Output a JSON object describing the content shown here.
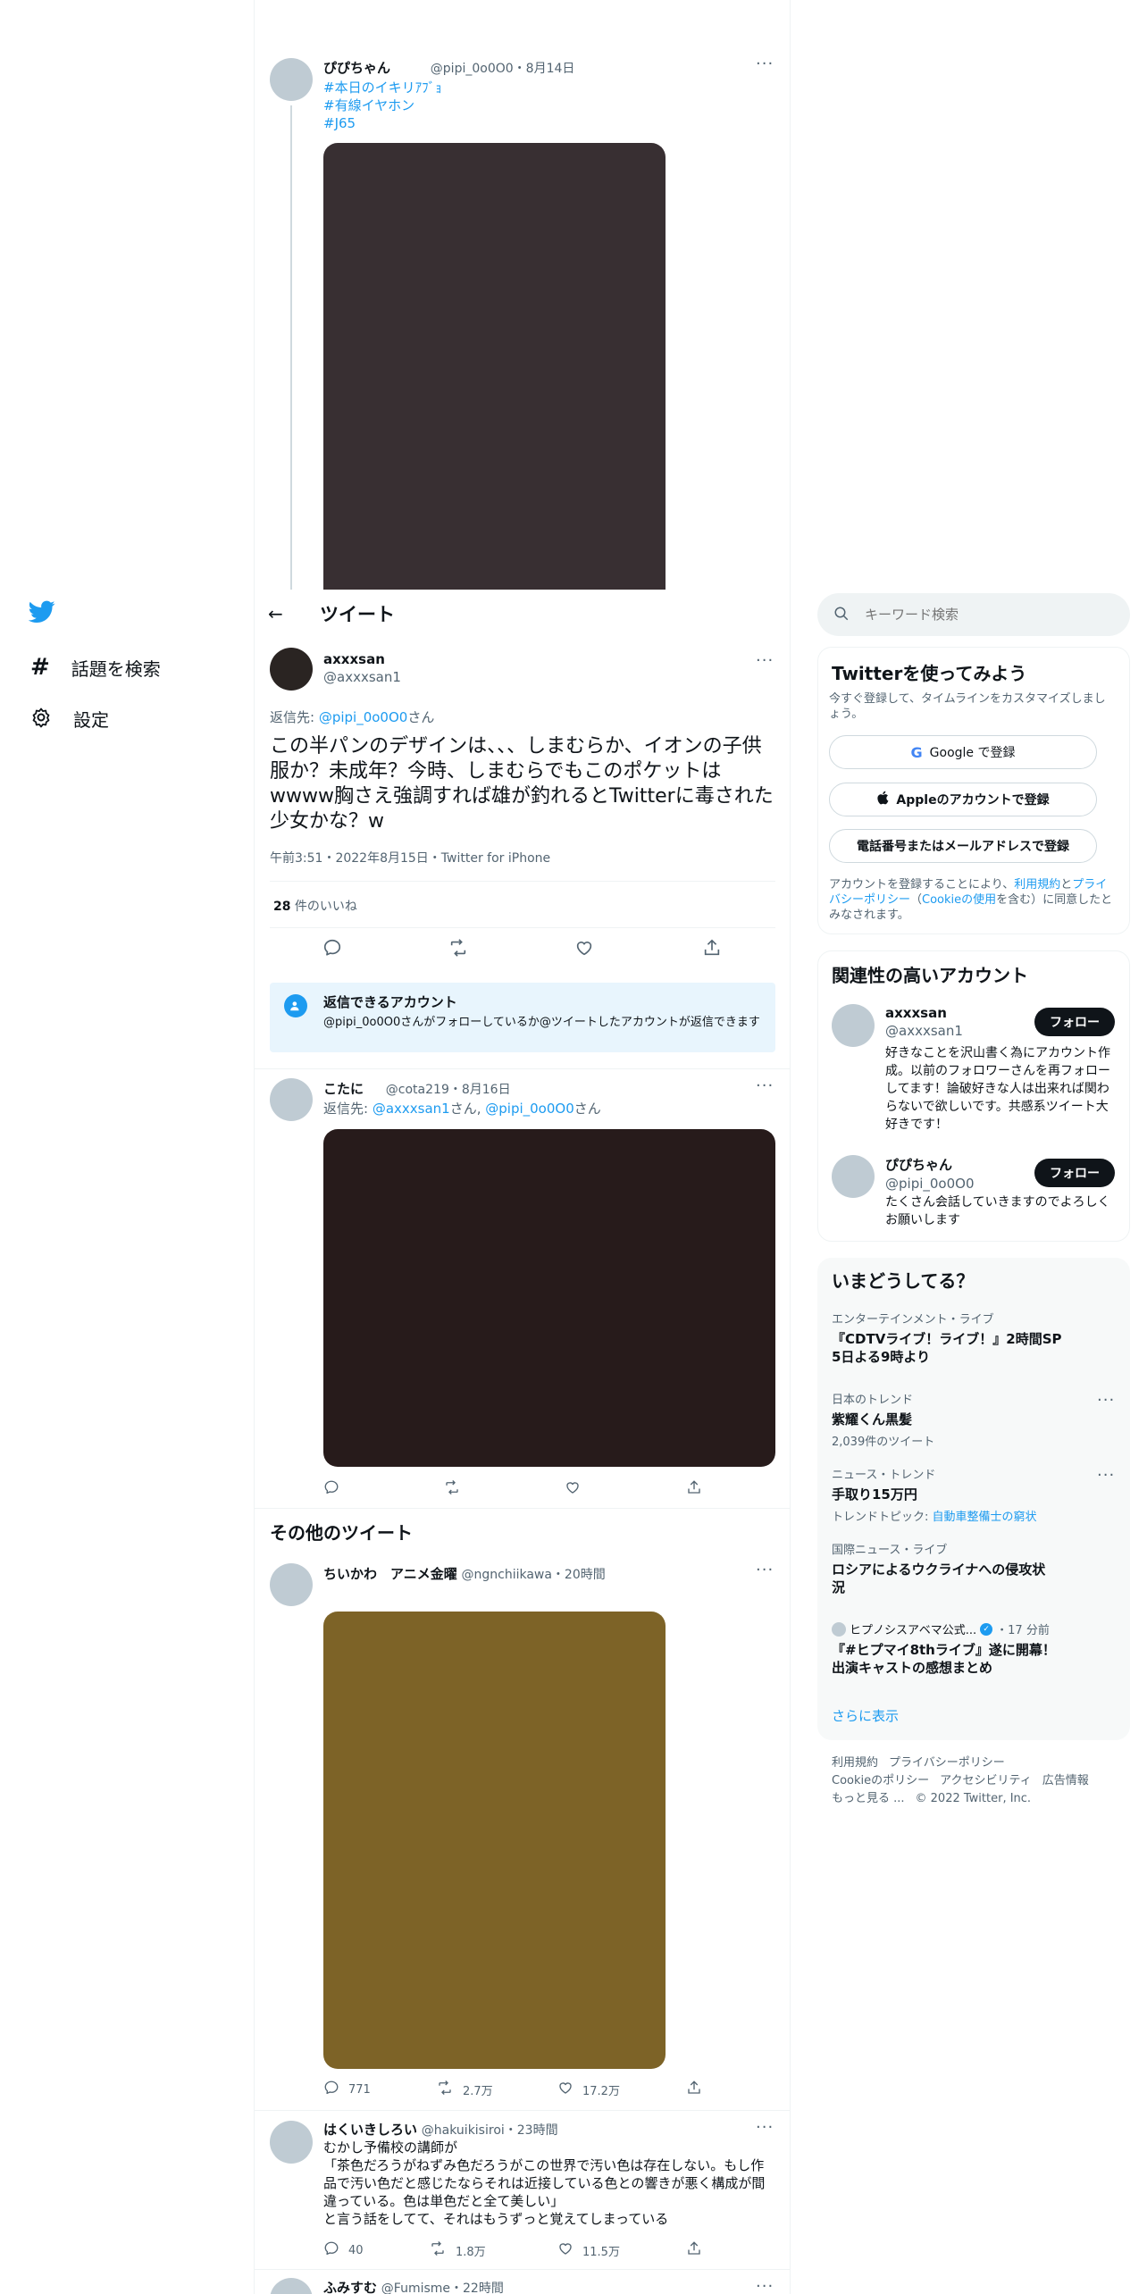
{
  "nav": {
    "explore_label": "話題を検索",
    "settings_label": "設定"
  },
  "header": {
    "title": "ツイート"
  },
  "parent_tweet": {
    "name": "ぴぴちゃん",
    "handle_time": "@pipi_0o0O0・8月14日",
    "tags": [
      "#本日のイキリｱﾌﾞｮ",
      "#有線イヤホン",
      "#J65"
    ]
  },
  "main_tweet": {
    "name": "axxxsan",
    "handle": "@axxxsan1",
    "reply_prefix": "返信先: ",
    "reply_handle": "@pipi_0o0O0",
    "reply_suffix": "さん",
    "text": "この半パンのデザインは、、、しまむらか、イオンの子供服か？未成年？今時、しまむらでもこのポケットはwwww胸さえ強調すれば雄が釣れるとTwitterに毒された少女かな？w",
    "timestamp": "午前3:51・2022年8月15日・Twitter for iPhone",
    "likes_count": "28",
    "likes_label": " 件のいいね"
  },
  "reply_notice": {
    "title": "返信できるアカウント",
    "body": "@pipi_0o0O0さんがフォローしているか@ツイートしたアカウントが返信できます"
  },
  "reply_tweet": {
    "name": "こたに",
    "handle_time": "@cota219・8月16日",
    "reply_prefix": "返信先: ",
    "reply_handle1": "@axxxsan1",
    "reply_mid": "さん, ",
    "reply_handle2": "@pipi_0o0O0",
    "reply_suffix": "さん"
  },
  "more_tweets": {
    "heading": "その他のツイート",
    "tweets": [
      {
        "name": "ちいかわ　アニメ金曜",
        "handle_time": "@ngnchiikawa・20時間",
        "replies": "771",
        "retweets": "2.7万",
        "likes": "17.2万"
      },
      {
        "name": "はくいきしろい",
        "handle_time": "@hakuikisiroi・23時間",
        "text": "むかし予備校の講師が\n「茶色だろうがねずみ色だろうがこの世界で汚い色は存在しない。もし作品で汚い色だと感じたならそれは近接している色との響きが悪く構成が間違っている。色は単色だと全て美しい」\nと言う話をしてて、それはもうずっと覚えてしまっている",
        "replies": "40",
        "retweets": "1.8万",
        "likes": "11.5万"
      },
      {
        "name": "ふみすむ",
        "handle_time": "@Fumisme・22時間"
      }
    ]
  },
  "search": {
    "placeholder": "キーワード検索"
  },
  "signup_card": {
    "title": "Twitterを使ってみよう",
    "subtitle": "今すぐ登録して、タイムラインをカスタマイズしましょう。",
    "google_label": "Google で登録",
    "apple_label": "Appleのアカウントで登録",
    "phone_label": "電話番号またはメールアドレスで登録",
    "legal_prefix": "アカウントを登録することにより、",
    "legal_terms": "利用規約",
    "legal_and": "と",
    "legal_privacy": "プライバシーポリシー",
    "legal_paren_open": "（",
    "legal_cookie": "Cookieの使用",
    "legal_suffix": "を含む）に同意したとみなされます。"
  },
  "related_accounts": {
    "title": "関連性の高いアカウント",
    "follow_label": "フォロー",
    "accounts": [
      {
        "name": "axxxsan",
        "handle": "@axxxsan1",
        "bio": "好きなことを沢山書く為にアカウント作成。以前のフォロワーさんを再フォローしてます！論破好きな人は出来れば関わらないで欲しいです。共感系ツイート大好きです！"
      },
      {
        "name": "ぴぴちゃん",
        "handle": "@pipi_0o0O0",
        "bio": "たくさん会話していきますのでよろしくお願いします"
      }
    ]
  },
  "trends": {
    "title": "いまどうしてる？",
    "items": [
      {
        "meta": "エンターテインメント・ライブ",
        "title": "『CDTVライブ！ライブ！』2時間SP 5日よる9時より"
      },
      {
        "meta": "日本のトレンド",
        "title": "紫耀くん黒髪",
        "count": "2,039件のツイート"
      },
      {
        "meta": "ニュース・トレンド",
        "title": "手取り15万円",
        "topic_prefix": "トレンドトピック: ",
        "topic": "自動車整備士の窮状"
      },
      {
        "meta": "国際ニュース・ライブ",
        "title": "ロシアによるウクライナへの侵攻状況"
      },
      {
        "meta_name": "ヒプノシスアベマ公式...",
        "meta_time": "・17 分前",
        "title": "『#ヒプマイ8thライブ』遂に開幕！出演キャストの感想まとめ"
      }
    ],
    "show_more": "さらに表示"
  },
  "footer": {
    "links": [
      "利用規約",
      "プライバシーポリシー",
      "Cookieのポリシー",
      "アクセシビリティ",
      "広告情報",
      "もっと見る ..."
    ],
    "copyright": "© 2022 Twitter, Inc."
  },
  "colors": {
    "accent": "#1d9bf0",
    "parent_image": "#382f32",
    "reply_image": "#271b1b",
    "more_image": "#7d6327"
  }
}
